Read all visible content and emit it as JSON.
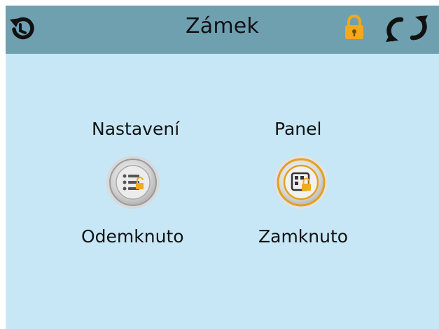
{
  "header": {
    "title": "Zámek",
    "back_icon": "back-arrow-icon",
    "lock_icon": "padlock-locked-icon",
    "refresh_icon": "refresh-arrows-icon",
    "bar_color": "#6fa0b0",
    "lock_color": "#f2a91a"
  },
  "main": {
    "background_color": "#c7e7f6",
    "items": [
      {
        "title": "Nastavení",
        "icon": "settings-list-icon",
        "status": "Odemknuto"
      },
      {
        "title": "Panel",
        "icon": "panel-locked-icon",
        "status": "Zamknuto"
      }
    ]
  }
}
